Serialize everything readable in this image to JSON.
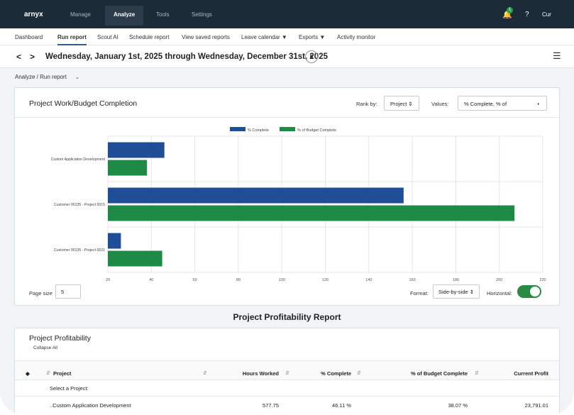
{
  "topnav": {
    "brand": "arnyx",
    "items": [
      "Manage",
      "Analyze",
      "Tools",
      "Settings"
    ],
    "notification_count": "1",
    "help": "?",
    "user": "Cur"
  },
  "subnav": {
    "items": [
      "Dashboard",
      "Run report",
      "Scout AI",
      "Schedule report",
      "View saved reports",
      "Leave calendar ▼",
      "Exports ▼",
      "Activity monitor"
    ]
  },
  "datebar": {
    "prev": "<",
    "next": ">",
    "title": "Wednesday, January 1st, 2025 through Wednesday, December 31st, 2025"
  },
  "breadcrumb": {
    "text": "Analyze / Run report"
  },
  "chart_card": {
    "title": "Project Work/Budget Completion",
    "rank_by_label": "Rank by:",
    "rank_by_value": "Project ⇕",
    "values_label": "Values:",
    "values_value": "% Complete, % of",
    "page_size_label": "Page size",
    "page_size_value": "5",
    "format_label": "Format:",
    "format_value": "Side-by-side ⇕",
    "horizontal_label": "Horizontal:"
  },
  "chart_data": {
    "type": "bar",
    "orientation": "horizontal",
    "categories": [
      "Custom Application Development",
      "Customer 00135 - Project 0015",
      "Customer 00135 - Project 0021"
    ],
    "series": [
      {
        "name": "% Complete",
        "color": "#1f4e96",
        "values": [
          46,
          156,
          26
        ]
      },
      {
        "name": "% of Budget Complete",
        "color": "#1e8a45",
        "values": [
          38,
          207,
          45
        ]
      }
    ],
    "xlim": [
      20,
      220
    ],
    "xticks": [
      20,
      40,
      60,
      80,
      100,
      120,
      140,
      160,
      180,
      200,
      220
    ],
    "legend": "top-center",
    "grid": true
  },
  "section_title": "Project Profitability Report",
  "table_card": {
    "title": "Project Profitability",
    "collapse": "Collapse All",
    "columns": [
      "Project",
      "Hours Worked",
      "% Complete",
      "% of Budget Complete",
      "Current Profit"
    ],
    "select_label": "Select a Project:",
    "rows": [
      {
        "project": "..Custom Application Development",
        "hours": "577.75",
        "complete": "46.11 %",
        "budget": "38.07 %",
        "profit": "23,791.01"
      }
    ]
  }
}
